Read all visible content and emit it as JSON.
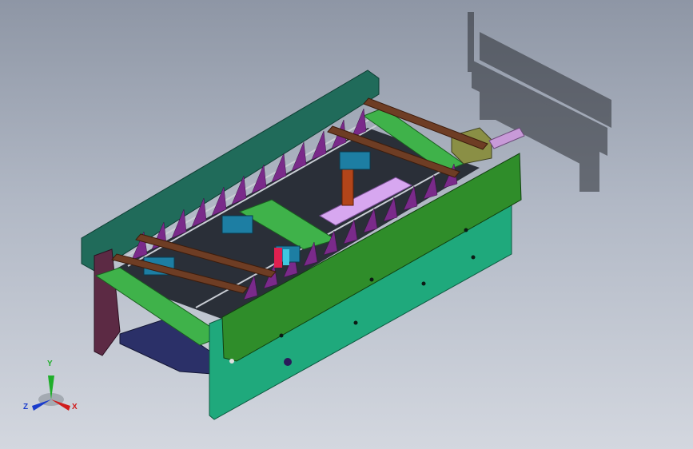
{
  "viewport": {
    "title": "",
    "background_top": "#8e96a5",
    "background_bottom": "#d3d7df"
  },
  "model": {
    "frame_color": "#206b5a",
    "side_panel_color": "#1fa97c",
    "cover_color": "#2f8d2a",
    "fin_color": "#7a2a8a",
    "roller_color": "#6e3d24",
    "bearing_color": "#1d7ea3",
    "actuator_color": "#d7a7f0",
    "motor_color": "#8a8f45",
    "shaft_color": "#c89ad8"
  },
  "triad": {
    "x_label": "X",
    "y_label": "Y",
    "z_label": "Z",
    "x_color": "#d01c1c",
    "y_color": "#1fae2a",
    "z_color": "#1a3ccc"
  }
}
